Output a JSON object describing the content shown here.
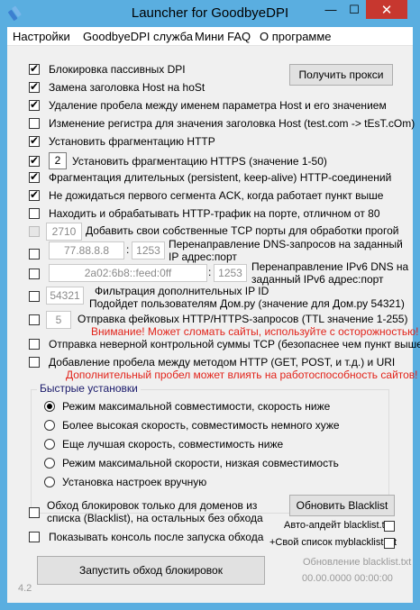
{
  "window": {
    "title": "Launcher for GoodbyeDPI",
    "controls": {
      "minimize": "—",
      "maximize": "☐",
      "close": "✕"
    },
    "colors": {
      "frame": "#5aaee0",
      "close": "#c7372f",
      "warning": "#e2231a"
    }
  },
  "menu": [
    "Настройки",
    "GoodbyeDPI служба",
    "Мини FAQ",
    "О программе"
  ],
  "options": [
    {
      "label": "Блокировка пассивных DPI",
      "checked": true
    },
    {
      "label": "Замена заголовка Host на hoSt",
      "checked": true
    },
    {
      "label": "Удаление пробела между именем параметра Host и его значением",
      "checked": true
    },
    {
      "label": "Изменение регистра для значения заголовка Host (test.com -> tEsT.cOm)",
      "checked": false
    },
    {
      "label": "Установить фрагментацию HTTP",
      "checked": true
    },
    {
      "label": "Установить фрагментацию HTTPS (значение 1-50)",
      "checked": true,
      "value": "2"
    },
    {
      "label": "Фрагментация длительных (persistent, keep-alive) HTTP-соединений",
      "checked": true
    },
    {
      "label": "Не дожидаться первого сегмента ACK, когда работает пункт выше",
      "checked": true
    },
    {
      "label": "Находить и обрабатывать HTTP-трафик на порте, отличном от 80",
      "checked": false
    }
  ],
  "get_proxy_button": "Получить прокси",
  "ports": {
    "value": "2710",
    "label": "Добавить свои собственные TCP порты для обработки прогой"
  },
  "dns": {
    "ip": "77.88.8.8",
    "colon": ":",
    "port": "1253",
    "label1": "Перенаправление DNS-запросов на заданный",
    "label2": "IP адрес:порт"
  },
  "dns6": {
    "ip": "2a02:6b8::feed:0ff",
    "colon": ":",
    "port": "1253",
    "label1": "Перенаправление IPv6 DNS на",
    "label2": "заданный IPv6 адрес:порт"
  },
  "ipid": {
    "value": "54321",
    "label1": "Фильтрация дополнительных IP ID",
    "label2": "Подойдет пользователям Дом.ру (значение для Дом.ру 54321)"
  },
  "fake": {
    "value": "5",
    "label": "Отправка фейковых HTTP/HTTPS-запросов (TTL значение 1-255)",
    "warning": "Внимание! Может сломать сайты, используйте с осторожностью!"
  },
  "wrong_checksum": "Отправка неверной контрольной суммы TCP (безопаснее чем пункт выше)",
  "space": {
    "label": "Добавление пробела между методом HTTP (GET, POST, и т.д.) и URI",
    "warning": "Дополнительный пробел может влиять на работоспособность сайтов!"
  },
  "quick": {
    "title": "Быстрые установки",
    "selected": 0,
    "options": [
      "Режим максимальной совместимости, скорость ниже",
      "Более высокая скорость, совместимость немного хуже",
      "Еще лучшая скорость, совместимость ниже",
      "Режим максимальной скорости, низкая совместимость",
      "Установка настроек вручную"
    ]
  },
  "blacklist": {
    "domains_only_line1": "Обход блокировок только для доменов из",
    "domains_only_line2": "списка (Blacklist), на остальных без обхода",
    "update_button": "Обновить Blacklist",
    "auto_update": "Авто-апдейт blacklist.txt",
    "own_list": "+Свой список myblacklist.txt",
    "update_label": "Обновление blacklist.txt",
    "update_time": "00.00.0000 00:00:00"
  },
  "show_console": "Показывать консоль после запуска обхода",
  "start_button": "Запустить обход блокировок",
  "version": "4.2"
}
